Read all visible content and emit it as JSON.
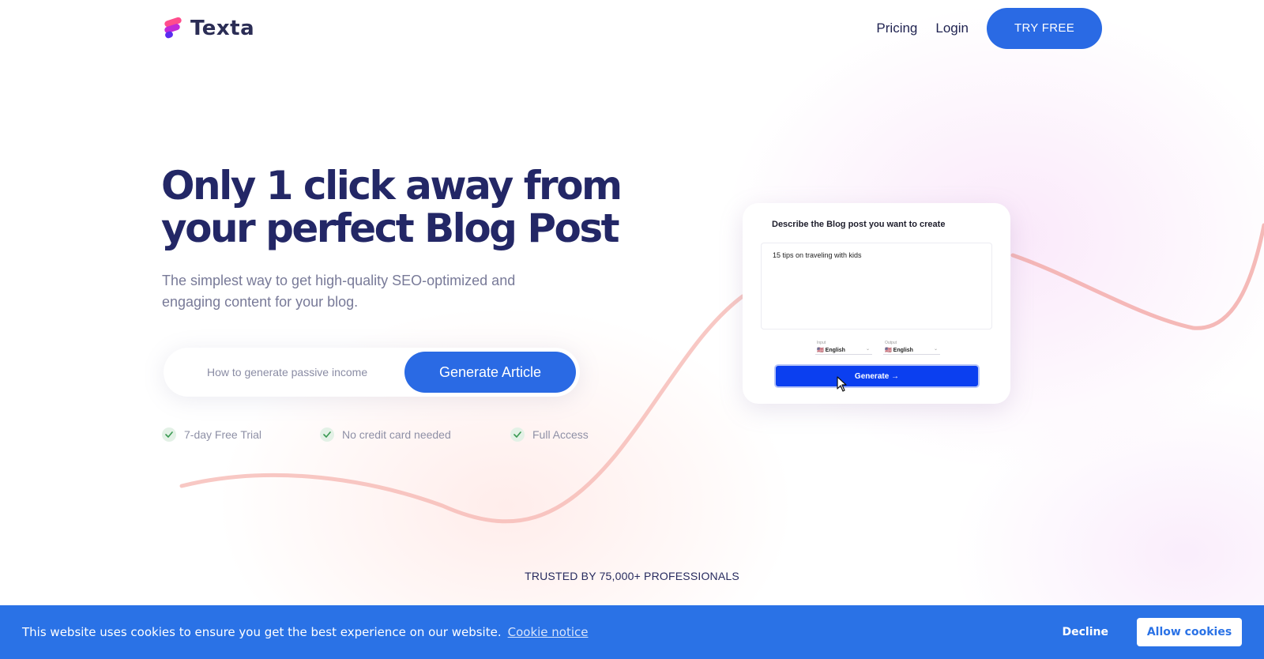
{
  "colors": {
    "accent": "#2a6ae4",
    "heading": "#232766",
    "cookie_bar": "#2a72e6",
    "wave": "#f6b6b0"
  },
  "header": {
    "logo_icon": "texta-logo-icon",
    "brand_name": "Texta",
    "nav": {
      "pricing": "Pricing",
      "login": "Login",
      "cta": "TRY FREE"
    }
  },
  "hero": {
    "title_line1": "Only 1 click away from",
    "title_line2": "your perfect Blog Post",
    "subtitle": "The simplest way to get high-quality SEO-optimized and engaging content for your blog.",
    "search": {
      "placeholder": "How to generate passive income",
      "button": "Generate Article"
    },
    "features": [
      {
        "icon": "check-icon",
        "label": "7-day Free Trial"
      },
      {
        "icon": "check-icon",
        "label": "No credit card needed"
      },
      {
        "icon": "check-icon",
        "label": "Full Access"
      }
    ]
  },
  "demo": {
    "label": "Describe the Blog post you want to create",
    "textarea_value": "15 tips on traveling with kids",
    "input_select": {
      "caption": "Input",
      "value": "🇺🇸 English"
    },
    "output_select": {
      "caption": "Output",
      "value": "🇺🇸 English"
    },
    "button": "Generate →"
  },
  "trusted": "TRUSTED BY 75,000+ PROFESSIONALS",
  "cookie": {
    "message": "This website uses cookies to ensure you get the best experience on our website.",
    "link": "Cookie notice",
    "decline": "Decline",
    "allow": "Allow cookies"
  }
}
